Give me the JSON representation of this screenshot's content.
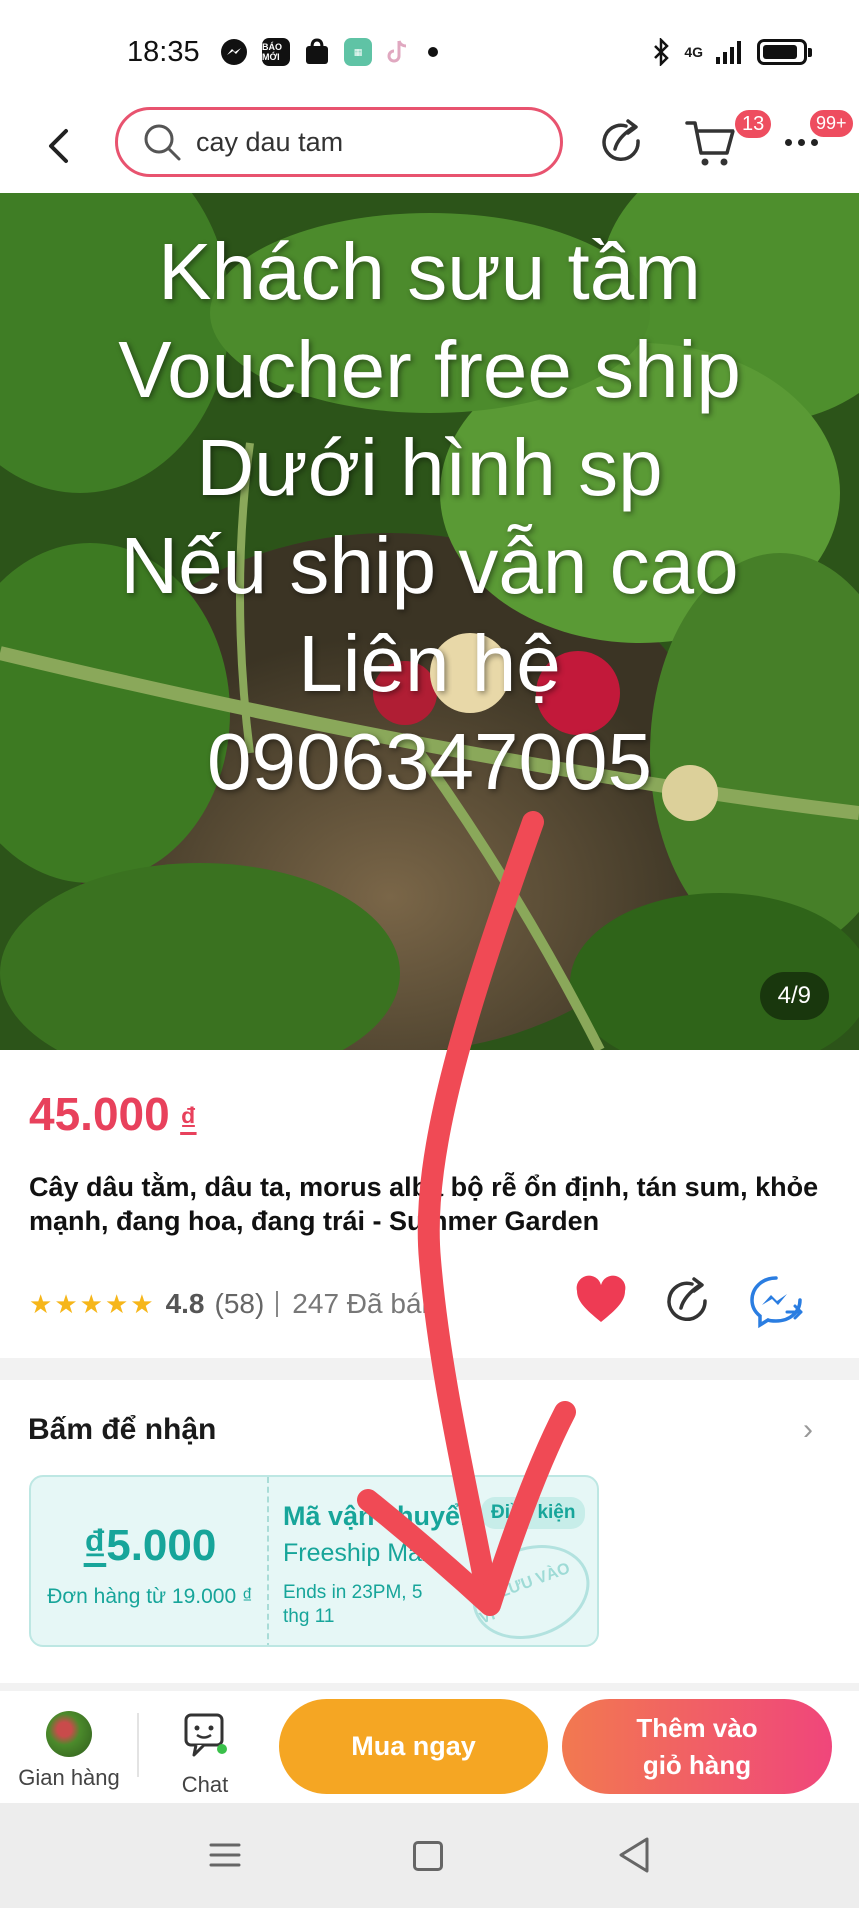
{
  "status_bar": {
    "time": "18:35",
    "apps": [
      "messenger-icon",
      "baomoi-icon",
      "shopee-icon",
      "calculator-icon",
      "tiktok-icon"
    ],
    "baomoi_text": "BÁO MỚI",
    "network": "4G"
  },
  "top_bar": {
    "search_value": "cay dau tam",
    "cart_badge": "13",
    "more_badge": "99+"
  },
  "product_image": {
    "overlay_lines": [
      "Khách sưu tầm",
      "Voucher free ship",
      "Dưới hình sp",
      "Nếu ship vẫn cao",
      "Liên hệ",
      "0906347005"
    ],
    "counter": "4/9"
  },
  "product": {
    "price": "45.000",
    "currency": "₫",
    "title": "Cây dâu tằm, dâu ta, morus alba bộ rễ ổn định, tán sum, khỏe mạnh, đang hoa, đang trái - Summer Garden",
    "rating": "4.8",
    "rating_count": "(58)",
    "sold": "247 Đã bán"
  },
  "voucher": {
    "heading": "Bấm để nhận",
    "amount_currency": "₫",
    "amount": "5.000",
    "min_order": "Đơn hàng từ 19.000 ₫",
    "title": "Mã vận chuyển",
    "subtitle": "Freeship Max",
    "ends": "Ends in 23PM, 5 thg 11",
    "condition": "Điều kiện",
    "stamp": "ĐÃ LƯU VÀO VÍ"
  },
  "bottom_bar": {
    "shop_label": "Gian hàng",
    "chat_label": "Chat",
    "buy_now": "Mua ngay",
    "add_to_cart_line1": "Thêm vào",
    "add_to_cart_line2": "giỏ hàng"
  },
  "colors": {
    "accent": "#e8415c",
    "voucher": "#17a59a",
    "buy_now": "#f5a623",
    "arrow": "#f04a55"
  }
}
